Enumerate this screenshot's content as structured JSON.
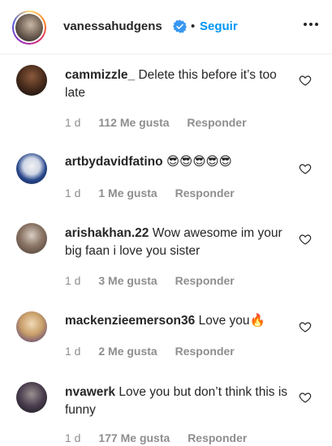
{
  "header": {
    "username": "vanessahudgens",
    "separator": "•",
    "follow_label": "Seguir"
  },
  "comments": [
    {
      "username": "cammizzle_",
      "text": "Delete this before it’s too late",
      "time": "1 d",
      "likes": "112 Me gusta",
      "reply": "Responder"
    },
    {
      "username": "artbydavidfatino",
      "text": "😎😎😎😎😎",
      "time": "1 d",
      "likes": "1 Me gusta",
      "reply": "Responder"
    },
    {
      "username": "arishakhan.22",
      "text": "Wow awesome im your big faan i love you sister",
      "time": "1 d",
      "likes": "3 Me gusta",
      "reply": "Responder"
    },
    {
      "username": "mackenzieemerson36",
      "text": "Love you🔥",
      "time": "1 d",
      "likes": "2 Me gusta",
      "reply": "Responder"
    },
    {
      "username": "nvawerk",
      "text": "Love you but don’t think this is funny",
      "time": "1 d",
      "likes": "177 Me gusta",
      "reply": "Responder"
    }
  ],
  "colors": {
    "accent": "#0095f6",
    "verified": "#3897f0",
    "meta": "#8e8e8e"
  }
}
